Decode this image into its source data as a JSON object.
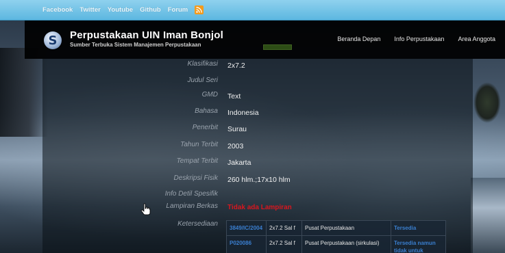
{
  "topbar": {
    "links": [
      "Facebook",
      "Twitter",
      "Youtube",
      "Github",
      "Forum"
    ],
    "rss_icon": "rss-icon"
  },
  "header": {
    "logo_letter": "S",
    "title": "Perpustakaan UIN Iman Bonjol",
    "subtitle": "Sumber Terbuka Sistem Manajemen Perpustakaan",
    "nav": [
      "Beranda Depan",
      "Info Perpustakaan",
      "Area Anggota"
    ]
  },
  "details": [
    {
      "label": "Klasifikasi",
      "value": "2x7.2"
    },
    {
      "label": "Judul Seri",
      "value": ""
    },
    {
      "label": "GMD",
      "value": "Text"
    },
    {
      "label": "Bahasa",
      "value": "Indonesia"
    },
    {
      "label": "Penerbit",
      "value": "Surau"
    },
    {
      "label": "Tahun Terbit",
      "value": "2003"
    },
    {
      "label": "Tempat Terbit",
      "value": "Jakarta"
    },
    {
      "label": "Deskripsi Fisik",
      "value": "260 hlm.;17x10 hlm"
    },
    {
      "label": "Info Detil Spesifik",
      "value": ""
    },
    {
      "label": "Lampiran Berkas",
      "value": "Tidak ada Lampiran"
    },
    {
      "label": "Ketersediaan",
      "value": ""
    }
  ],
  "availability": [
    {
      "code": "3849/IC/2004",
      "classification": "2x7.2 Sal f",
      "location": "Pusat Perpustakaan",
      "status": "Tersedia"
    },
    {
      "code": "P020086",
      "classification": "2x7.2 Sal f",
      "location": "Pusat Perpustakaan (sirkulasi)",
      "status": "Tersedia namun tidak untuk"
    }
  ],
  "colors": {
    "topbar": "#5cb7e0",
    "header_bg": "#000000",
    "link_blue": "#3a7fd0",
    "attachment_red": "#d8171f",
    "rss": "#f39a1c"
  }
}
